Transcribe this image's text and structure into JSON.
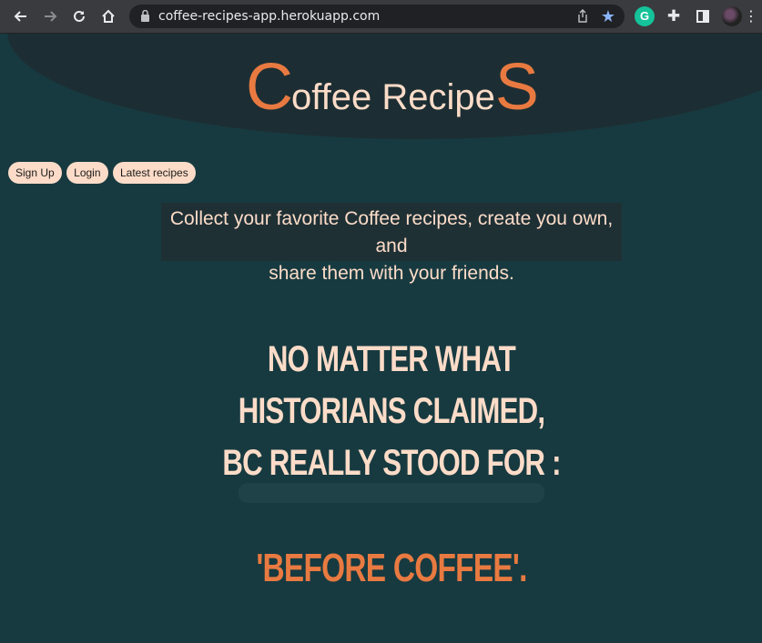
{
  "browser": {
    "url": "coffee-recipes-app.herokuapp.com",
    "extension_letter": "G"
  },
  "site": {
    "title_first_letter": "C",
    "title_middle": "offee Recipe",
    "title_last_letter": "S"
  },
  "nav": {
    "signup_label": "Sign Up",
    "login_label": "Login",
    "latest_label": "Latest recipes"
  },
  "tagline": {
    "line1": "Collect your favorite Coffee recipes, create you own, and",
    "line2": "share them with your friends."
  },
  "quote": {
    "line1": "No matter what",
    "line2": "historians claimed,",
    "line3": "BC really stood for :",
    "punchline": "'Before Coffee'."
  },
  "colors": {
    "background": "#173a40",
    "accent": "#e87a41",
    "cream": "#fcdcc8"
  },
  "icons": [
    "back-arrow-icon",
    "forward-arrow-icon",
    "reload-icon",
    "home-icon",
    "lock-icon",
    "share-icon",
    "star-icon",
    "grammarly-icon",
    "puzzle-icon",
    "side-panel-icon",
    "profile-avatar",
    "menu-icon"
  ]
}
